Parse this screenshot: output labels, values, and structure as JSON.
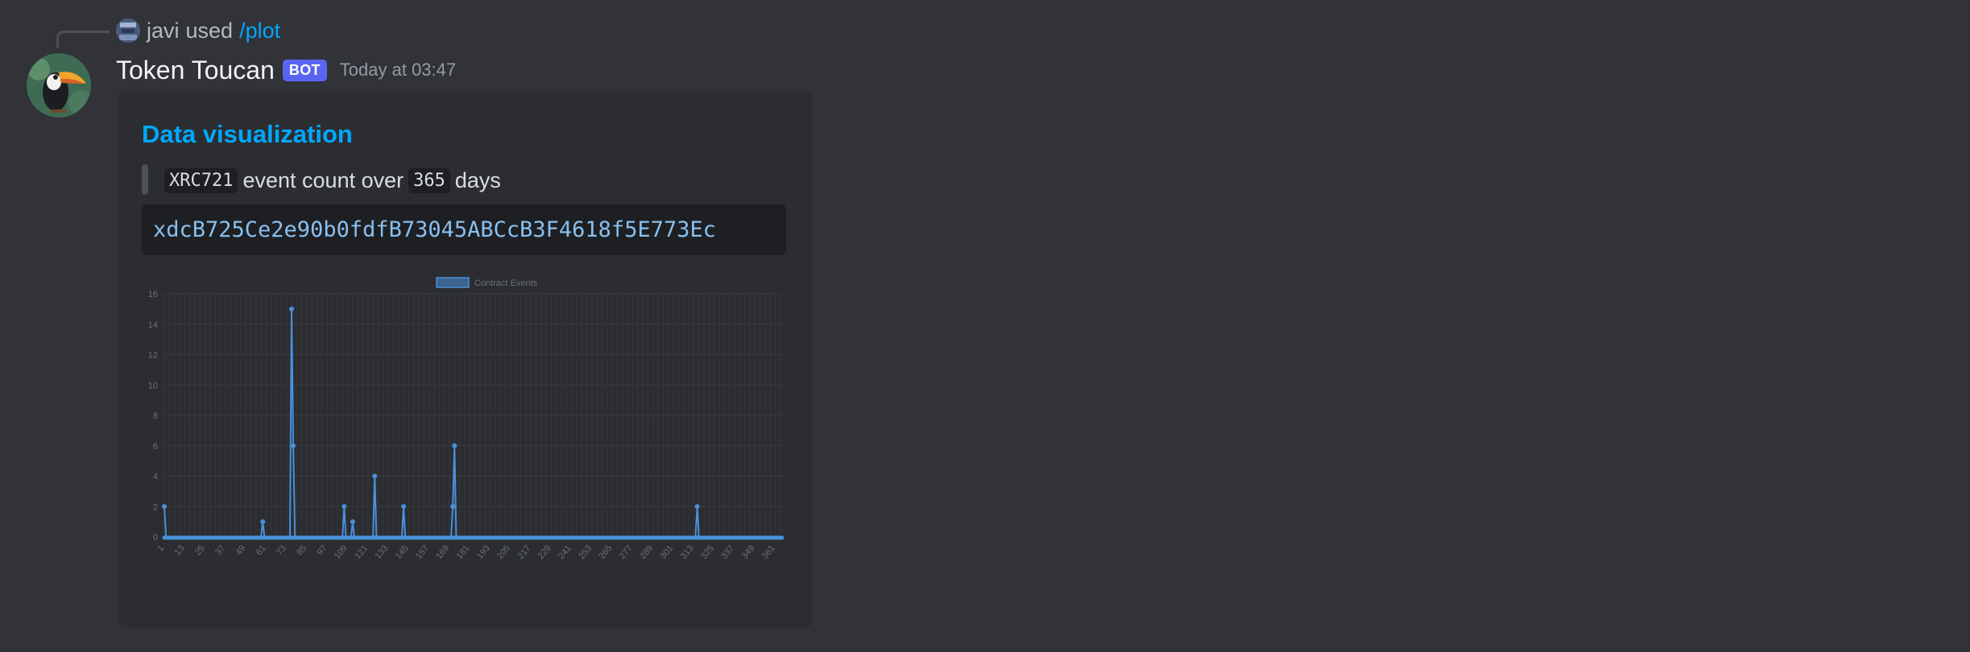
{
  "reply": {
    "user": "javi",
    "verb": "used",
    "command": "/plot"
  },
  "message": {
    "username": "Token Toucan",
    "bot_tag": "BOT",
    "timestamp": "Today at 03:47"
  },
  "embed": {
    "title": "Data visualization",
    "description": {
      "token": "XRC721",
      "middle": "event count over",
      "days": "365",
      "suffix": "days"
    },
    "address": "xdcB725Ce2e90b0fdfB73045ABCcB3F4618f5E773Ec"
  },
  "colors": {
    "background": "#313338",
    "embed_bg": "#2b2d31",
    "link": "#00a8fc",
    "bot_tag": "#5865f2",
    "series": "#4a90d9"
  },
  "chart_data": {
    "type": "line",
    "legend": "Contract Events",
    "legend_position": "top",
    "x_range": [
      1,
      365
    ],
    "ylim": [
      0,
      16
    ],
    "y_ticks": [
      0,
      2,
      4,
      6,
      8,
      10,
      12,
      14,
      16
    ],
    "x_ticks": [
      "1",
      "13",
      "25",
      "37",
      "49",
      "61",
      "73",
      "85",
      "97",
      "109",
      "121",
      "133",
      "145",
      "157",
      "169",
      "181",
      "193",
      "205",
      "217",
      "229",
      "241",
      "253",
      "265",
      "277",
      "289",
      "301",
      "313",
      "325",
      "337",
      "349",
      "361"
    ],
    "grid": true,
    "series": [
      {
        "name": "Contract Events",
        "points": [
          [
            1,
            2
          ],
          [
            59,
            1
          ],
          [
            76,
            15
          ],
          [
            77,
            6
          ],
          [
            107,
            2
          ],
          [
            112,
            1
          ],
          [
            125,
            4
          ],
          [
            142,
            2
          ],
          [
            171,
            2
          ],
          [
            172,
            6
          ],
          [
            315,
            2
          ]
        ]
      }
    ]
  }
}
